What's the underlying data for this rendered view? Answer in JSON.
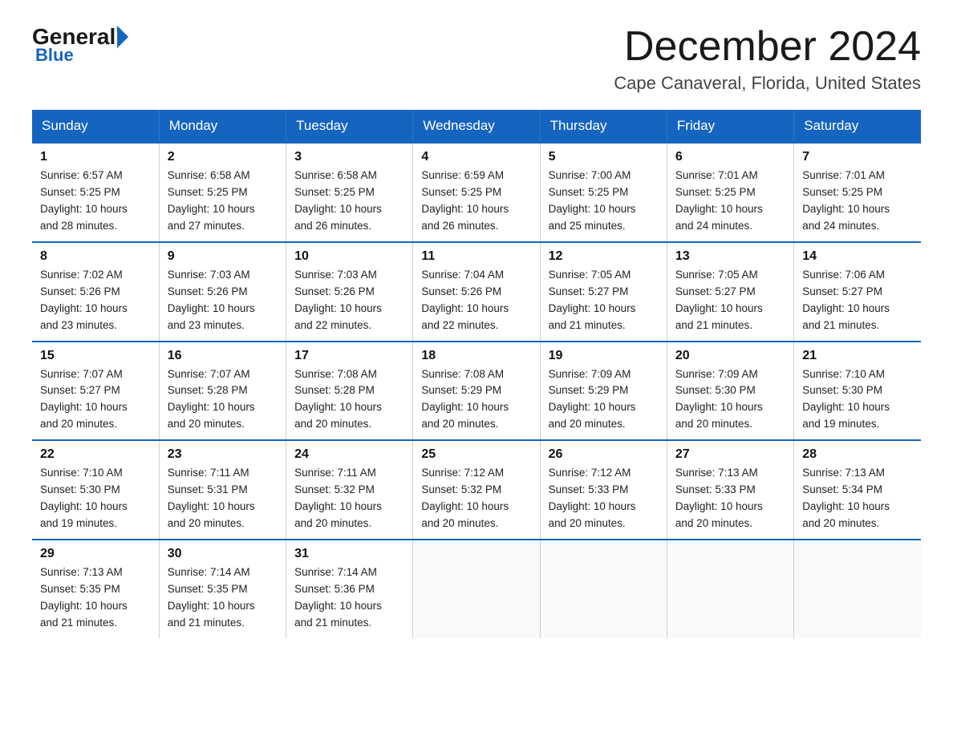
{
  "logo": {
    "general": "General",
    "blue": "Blue"
  },
  "title": "December 2024",
  "location": "Cape Canaveral, Florida, United States",
  "days_of_week": [
    "Sunday",
    "Monday",
    "Tuesday",
    "Wednesday",
    "Thursday",
    "Friday",
    "Saturday"
  ],
  "weeks": [
    [
      {
        "day": "1",
        "sunrise": "6:57 AM",
        "sunset": "5:25 PM",
        "daylight": "10 hours and 28 minutes."
      },
      {
        "day": "2",
        "sunrise": "6:58 AM",
        "sunset": "5:25 PM",
        "daylight": "10 hours and 27 minutes."
      },
      {
        "day": "3",
        "sunrise": "6:58 AM",
        "sunset": "5:25 PM",
        "daylight": "10 hours and 26 minutes."
      },
      {
        "day": "4",
        "sunrise": "6:59 AM",
        "sunset": "5:25 PM",
        "daylight": "10 hours and 26 minutes."
      },
      {
        "day": "5",
        "sunrise": "7:00 AM",
        "sunset": "5:25 PM",
        "daylight": "10 hours and 25 minutes."
      },
      {
        "day": "6",
        "sunrise": "7:01 AM",
        "sunset": "5:25 PM",
        "daylight": "10 hours and 24 minutes."
      },
      {
        "day": "7",
        "sunrise": "7:01 AM",
        "sunset": "5:25 PM",
        "daylight": "10 hours and 24 minutes."
      }
    ],
    [
      {
        "day": "8",
        "sunrise": "7:02 AM",
        "sunset": "5:26 PM",
        "daylight": "10 hours and 23 minutes."
      },
      {
        "day": "9",
        "sunrise": "7:03 AM",
        "sunset": "5:26 PM",
        "daylight": "10 hours and 23 minutes."
      },
      {
        "day": "10",
        "sunrise": "7:03 AM",
        "sunset": "5:26 PM",
        "daylight": "10 hours and 22 minutes."
      },
      {
        "day": "11",
        "sunrise": "7:04 AM",
        "sunset": "5:26 PM",
        "daylight": "10 hours and 22 minutes."
      },
      {
        "day": "12",
        "sunrise": "7:05 AM",
        "sunset": "5:27 PM",
        "daylight": "10 hours and 21 minutes."
      },
      {
        "day": "13",
        "sunrise": "7:05 AM",
        "sunset": "5:27 PM",
        "daylight": "10 hours and 21 minutes."
      },
      {
        "day": "14",
        "sunrise": "7:06 AM",
        "sunset": "5:27 PM",
        "daylight": "10 hours and 21 minutes."
      }
    ],
    [
      {
        "day": "15",
        "sunrise": "7:07 AM",
        "sunset": "5:27 PM",
        "daylight": "10 hours and 20 minutes."
      },
      {
        "day": "16",
        "sunrise": "7:07 AM",
        "sunset": "5:28 PM",
        "daylight": "10 hours and 20 minutes."
      },
      {
        "day": "17",
        "sunrise": "7:08 AM",
        "sunset": "5:28 PM",
        "daylight": "10 hours and 20 minutes."
      },
      {
        "day": "18",
        "sunrise": "7:08 AM",
        "sunset": "5:29 PM",
        "daylight": "10 hours and 20 minutes."
      },
      {
        "day": "19",
        "sunrise": "7:09 AM",
        "sunset": "5:29 PM",
        "daylight": "10 hours and 20 minutes."
      },
      {
        "day": "20",
        "sunrise": "7:09 AM",
        "sunset": "5:30 PM",
        "daylight": "10 hours and 20 minutes."
      },
      {
        "day": "21",
        "sunrise": "7:10 AM",
        "sunset": "5:30 PM",
        "daylight": "10 hours and 19 minutes."
      }
    ],
    [
      {
        "day": "22",
        "sunrise": "7:10 AM",
        "sunset": "5:30 PM",
        "daylight": "10 hours and 19 minutes."
      },
      {
        "day": "23",
        "sunrise": "7:11 AM",
        "sunset": "5:31 PM",
        "daylight": "10 hours and 20 minutes."
      },
      {
        "day": "24",
        "sunrise": "7:11 AM",
        "sunset": "5:32 PM",
        "daylight": "10 hours and 20 minutes."
      },
      {
        "day": "25",
        "sunrise": "7:12 AM",
        "sunset": "5:32 PM",
        "daylight": "10 hours and 20 minutes."
      },
      {
        "day": "26",
        "sunrise": "7:12 AM",
        "sunset": "5:33 PM",
        "daylight": "10 hours and 20 minutes."
      },
      {
        "day": "27",
        "sunrise": "7:13 AM",
        "sunset": "5:33 PM",
        "daylight": "10 hours and 20 minutes."
      },
      {
        "day": "28",
        "sunrise": "7:13 AM",
        "sunset": "5:34 PM",
        "daylight": "10 hours and 20 minutes."
      }
    ],
    [
      {
        "day": "29",
        "sunrise": "7:13 AM",
        "sunset": "5:35 PM",
        "daylight": "10 hours and 21 minutes."
      },
      {
        "day": "30",
        "sunrise": "7:14 AM",
        "sunset": "5:35 PM",
        "daylight": "10 hours and 21 minutes."
      },
      {
        "day": "31",
        "sunrise": "7:14 AM",
        "sunset": "5:36 PM",
        "daylight": "10 hours and 21 minutes."
      },
      null,
      null,
      null,
      null
    ]
  ],
  "labels": {
    "sunrise": "Sunrise:",
    "sunset": "Sunset:",
    "daylight": "Daylight:"
  }
}
